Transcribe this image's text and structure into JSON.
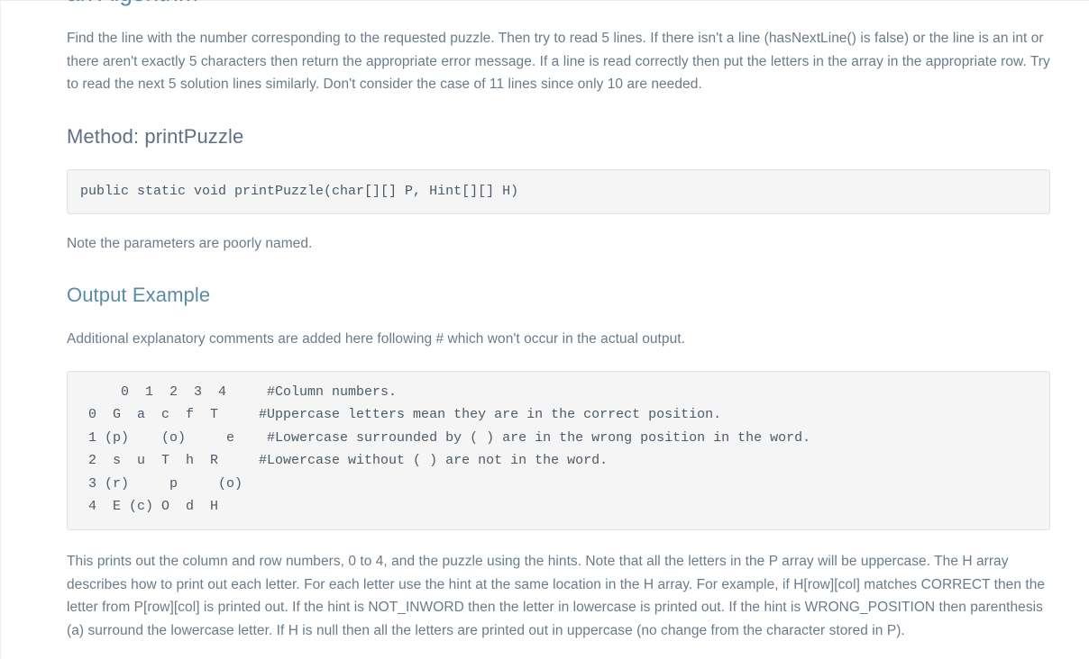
{
  "document": {
    "heading_clipped": "an Algorithm",
    "intro_paragraph": "Find the line with the number corresponding to the requested puzzle. Then try to read 5 lines. If there isn't a line (hasNextLine() is false) or the line is an int or there aren't exactly 5 characters then return the appropriate error message. If a line is read correctly then put the letters in the array in the appropriate row. Try to read the next 5 solution lines similarly. Don't consider the case of 11 lines since only 10 are needed.",
    "method_section": {
      "title": "Method: printPuzzle",
      "signature": "public static void printPuzzle(char[][] P, Hint[][] H)",
      "note": "Note the parameters are poorly named."
    },
    "output_section": {
      "title": "Output Example",
      "intro": "Additional explanatory comments are added here following # which won't occur in the actual output.",
      "block": "     0  1  2  3  4     #Column numbers.\n 0  G  a  c  f  T     #Uppercase letters mean they are in the correct position.\n 1 (p)    (o)     e    #Lowercase surrounded by ( ) are in the wrong position in the word.\n 2  s  u  T  h  R     #Lowercase without ( ) are not in the word.\n 3 (r)     p     (o)\n 4  E (c) O  d  H",
      "explanation": "This prints out the column and row numbers, 0 to 4, and the puzzle using the hints. Note that all the letters in the P array will be uppercase. The H array describes how to print out each letter. For each letter use the hint at the same location in the H array. For example, if H[row][col] matches CORRECT then the letter from P[row][col] is printed out. If the hint is NOT_INWORD then the letter in lowercase is printed out. If the hint is WRONG_POSITION then parenthesis (a) surround the lowercase letter. If H is null then all the letters are printed out in uppercase (no change from the character stored in P)."
    }
  },
  "grid_data": {
    "column_headers": [
      "0",
      "1",
      "2",
      "3",
      "4"
    ],
    "row_headers": [
      "0",
      "1",
      "2",
      "3",
      "4"
    ],
    "cells": [
      [
        "G",
        "a",
        "c",
        "f",
        "T"
      ],
      [
        "(p)",
        "",
        "(o)",
        "",
        "e"
      ],
      [
        "s",
        "u",
        "T",
        "h",
        "R"
      ],
      [
        "(r)",
        "",
        "p",
        "",
        "(o)"
      ],
      [
        "E",
        "(c)",
        "O",
        "d",
        "H"
      ]
    ],
    "comments": [
      "#Column numbers.",
      "#Uppercase letters mean they are in the correct position.",
      "#Lowercase surrounded by ( ) are in the wrong position in the word.",
      "#Lowercase without ( ) are not in the word."
    ]
  },
  "colors": {
    "heading_accent": "#5a8ca8",
    "body_text": "#6b7b8a",
    "code_background": "#f5f5f5",
    "code_border": "#e2e2e2",
    "code_text": "#4c5a68"
  }
}
